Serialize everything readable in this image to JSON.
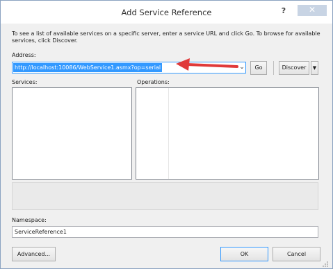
{
  "window": {
    "title": "Add Service Reference",
    "help_label": "?",
    "close_label": "✕"
  },
  "instructions": "To see a list of available services on a specific server, enter a service URL and click Go. To browse for available services, click Discover.",
  "address": {
    "label": "Address:",
    "value": "http://localhost:10086/WebService1.asmx?op=serial"
  },
  "buttons": {
    "go": "Go",
    "discover": "Discover",
    "advanced": "Advanced...",
    "ok": "OK",
    "cancel": "Cancel"
  },
  "services": {
    "label": "Services:"
  },
  "operations": {
    "label": "Operations:"
  },
  "namespace": {
    "label": "Namespace:",
    "value": "ServiceReference1"
  },
  "colors": {
    "selection": "#3399ff",
    "annotation_arrow": "#e03a3a"
  }
}
